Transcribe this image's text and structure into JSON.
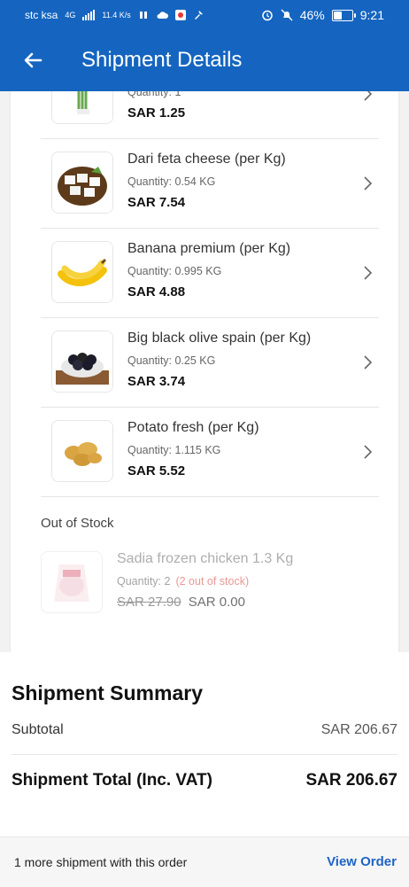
{
  "status_bar": {
    "carrier": "stc ksa",
    "net_type": "4G",
    "speed": "11.4 K/s",
    "battery": "46%",
    "battery_level": 0.46,
    "time": "9:21"
  },
  "header": {
    "title": "Shipment Details"
  },
  "items": [
    {
      "name": "",
      "quantity": "Quantity: 1",
      "price": "SAR 1.25"
    },
    {
      "name": "Dari feta cheese (per Kg)",
      "quantity": "Quantity: 0.54 KG",
      "price": "SAR 7.54"
    },
    {
      "name": "Banana premium (per Kg)",
      "quantity": "Quantity: 0.995 KG",
      "price": "SAR 4.88"
    },
    {
      "name": "Big black olive spain (per Kg)",
      "quantity": "Quantity: 0.25 KG",
      "price": "SAR 3.74"
    },
    {
      "name": "Potato fresh (per Kg)",
      "quantity": "Quantity: 1.115 KG",
      "price": "SAR 5.52"
    }
  ],
  "out_of_stock": {
    "header": "Out of Stock",
    "items": [
      {
        "name": "Sadia frozen chicken 1.3 Kg",
        "quantity": "Quantity: 2",
        "warning": "(2 out of stock)",
        "old_price": "SAR 27.90",
        "new_price": "SAR 0.00"
      }
    ]
  },
  "summary": {
    "title": "Shipment Summary",
    "subtotal_label": "Subtotal",
    "subtotal_value": "SAR 206.67",
    "total_label": "Shipment Total (Inc. VAT)",
    "total_value": "SAR 206.67"
  },
  "bottom_bar": {
    "text": "1 more shipment with this order",
    "button": "View Order"
  },
  "colors": {
    "primary": "#1565c0",
    "link": "#1e63c6",
    "warning": "#d9534f"
  }
}
